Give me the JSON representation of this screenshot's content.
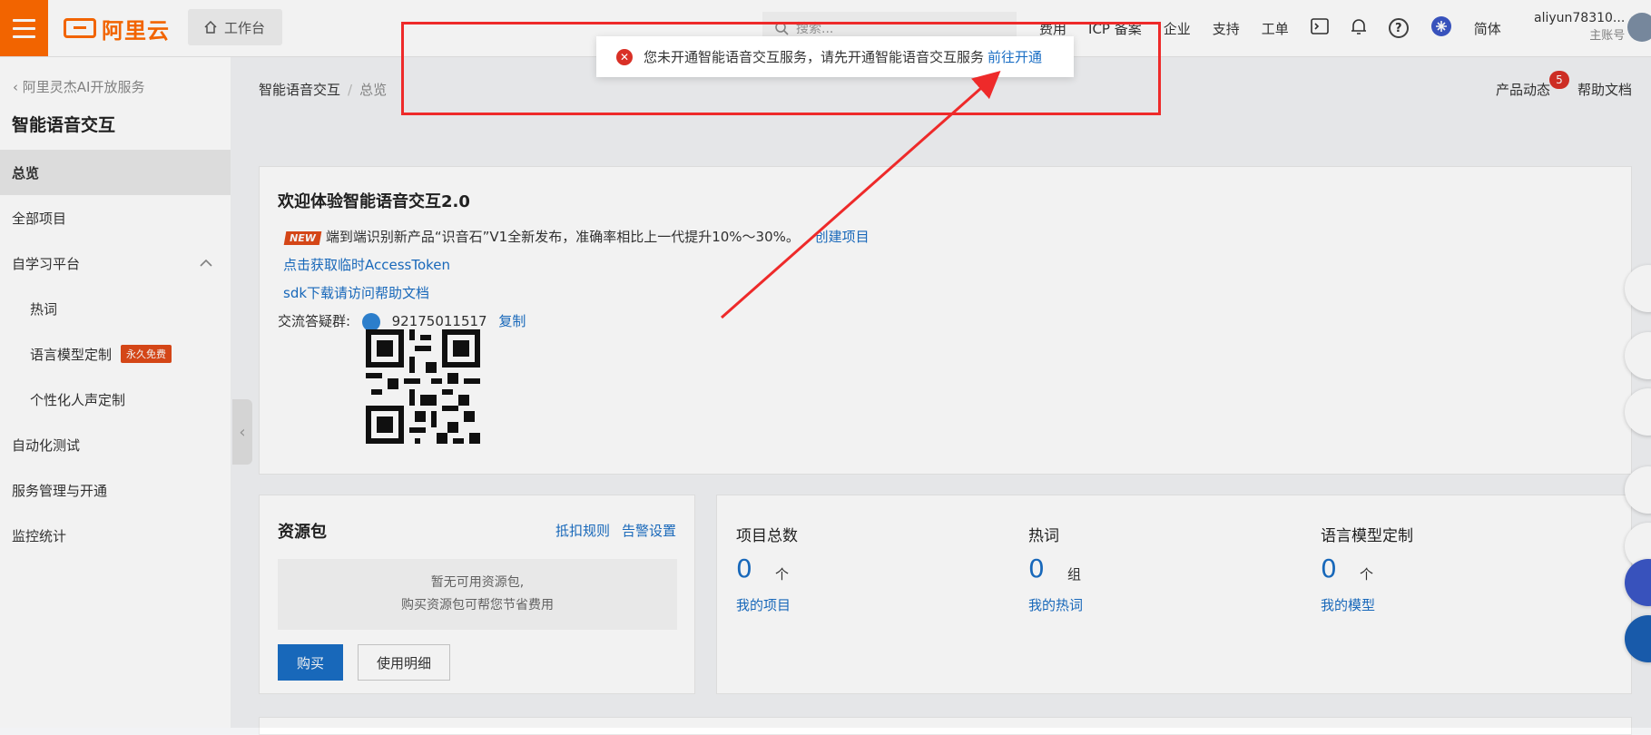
{
  "topbar": {
    "logo_text": "阿里云",
    "workbench": "工作台",
    "search_placeholder": "搜索...",
    "nav": [
      "费用",
      "ICP 备案",
      "企业",
      "支持",
      "工单"
    ],
    "lang": "简体",
    "user_name": "aliyun78310...",
    "user_role": "主账号"
  },
  "sidebar": {
    "back_label": "阿里灵杰AI开放服务",
    "product_title": "智能语音交互",
    "items": [
      {
        "label": "总览"
      },
      {
        "label": "全部项目"
      },
      {
        "label": "自学习平台"
      },
      {
        "label": "热词"
      },
      {
        "label": "语言模型定制",
        "badge": "永久免费"
      },
      {
        "label": "个性化人声定制"
      },
      {
        "label": "自动化测试"
      },
      {
        "label": "服务管理与开通"
      },
      {
        "label": "监控统计"
      }
    ]
  },
  "breadcrumb": {
    "root": "智能语音交互",
    "sep": "/",
    "current": "总览"
  },
  "header_links": {
    "news": "产品动态",
    "news_count": "5",
    "help": "帮助文档"
  },
  "welcome": {
    "title": "欢迎体验智能语音交互2.0",
    "new_tag": "NEW",
    "announcement": "端到端识别新产品“识音石”V1全新发布，准确率相比上一代提升10%～30%。",
    "create_link": "创建项目",
    "token_link": "点击获取临时AccessToken",
    "sdk_link": "sdk下载请访问帮助文档",
    "group_label": "交流答疑群:",
    "group_number": "92175011517",
    "copy_link": "复制"
  },
  "resource": {
    "title": "资源包",
    "rules_link": "抵扣规则",
    "alert_link": "告警设置",
    "empty_line1": "暂无可用资源包,",
    "empty_line2": "购买资源包可帮您节省费用",
    "buy_button": "购买",
    "detail_button": "使用明细"
  },
  "stats": [
    {
      "label": "项目总数",
      "value": "0",
      "unit": "个",
      "link": "我的项目"
    },
    {
      "label": "热词",
      "value": "0",
      "unit": "组",
      "link": "我的热词"
    },
    {
      "label": "语言模型定制",
      "value": "0",
      "unit": "个",
      "link": "我的模型"
    }
  ],
  "toast": {
    "message": "您未开通智能语音交互服务，请先开通智能语音交互服务",
    "link": "前往开通"
  },
  "colors": {
    "brand": "#ff6a00",
    "link": "#1a6ec4",
    "annotation": "#ee2a2a",
    "error": "#d93026"
  }
}
